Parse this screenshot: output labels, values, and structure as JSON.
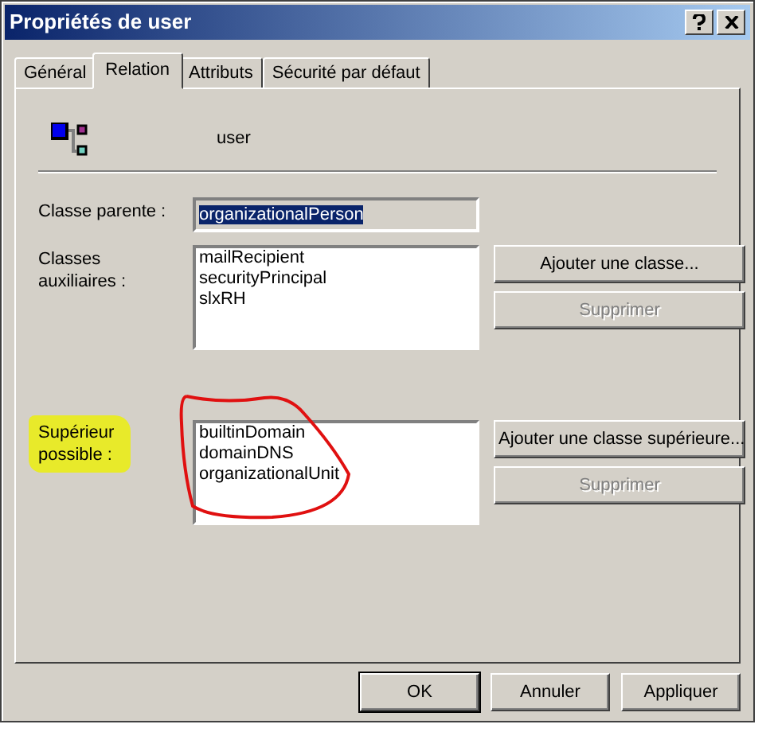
{
  "window": {
    "title": "Propriétés de user"
  },
  "tabs": [
    {
      "label": "Général",
      "selected": false
    },
    {
      "label": "Relation",
      "selected": true
    },
    {
      "label": "Attributs",
      "selected": false
    },
    {
      "label": "Sécurité par défaut",
      "selected": false
    }
  ],
  "header": {
    "name": "user"
  },
  "parent_class": {
    "label": "Classe parente :",
    "value": "organizationalPerson",
    "selected": true
  },
  "auxiliary_classes": {
    "label": "Classes auxiliaires :",
    "items": [
      "mailRecipient",
      "securityPrincipal",
      "slxRH"
    ],
    "buttons": [
      {
        "label": "Ajouter une classe...",
        "disabled": false
      },
      {
        "label": "Supprimer",
        "disabled": true
      }
    ]
  },
  "possible_superiors": {
    "label": "Supérieur possible :",
    "items": [
      "builtinDomain",
      "domainDNS",
      "organizationalUnit"
    ],
    "buttons": [
      {
        "label": "Ajouter une classe supérieure...",
        "disabled": false
      },
      {
        "label": "Supprimer",
        "disabled": true
      }
    ],
    "highlighted": true,
    "circled": true
  },
  "footer_buttons": [
    {
      "label": "OK",
      "default": true
    },
    {
      "label": "Annuler",
      "default": false
    },
    {
      "label": "Appliquer",
      "default": false
    }
  ]
}
